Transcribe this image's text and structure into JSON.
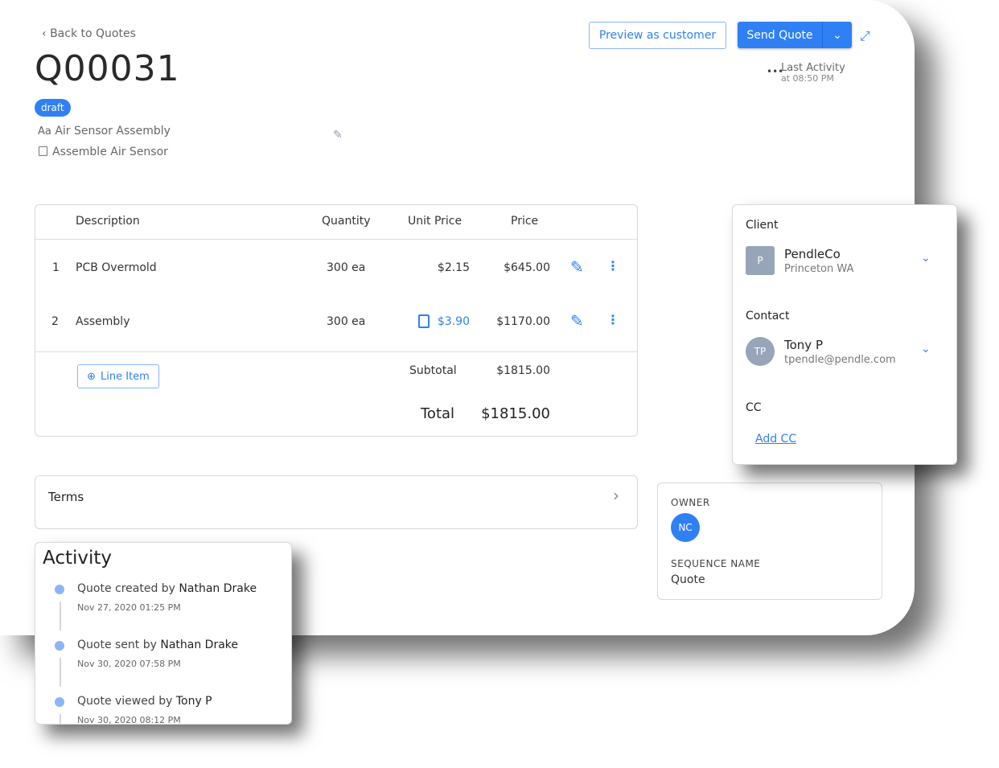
{
  "header": {
    "back_label": "Back to Quotes",
    "quote_id": "Q00031",
    "status": "draft",
    "name": "Air Sensor Assembly",
    "description": "Assemble Air Sensor",
    "preview_label": "Preview as customer",
    "send_label": "Send Quote",
    "last_activity_label": "Last Activity",
    "last_activity_time": "at 08:50 PM"
  },
  "table": {
    "columns": [
      "Description",
      "Quantity",
      "Unit Price",
      "Price"
    ],
    "rows": [
      {
        "num": "1",
        "description": "PCB Overmold",
        "quantity": "300 ea",
        "unit_price": "$2.15",
        "price": "$645.00"
      },
      {
        "num": "2",
        "description": "Assembly",
        "quantity": "300 ea",
        "unit_price": "$3.90",
        "price": "$1170.00"
      }
    ],
    "add_line_label": "Line Item",
    "subtotal_label": "Subtotal",
    "subtotal": "$1815.00",
    "total_label": "Total",
    "total": "$1815.00"
  },
  "terms": {
    "label": "Terms"
  },
  "client": {
    "label": "Client",
    "initial": "P",
    "name": "PendleCo",
    "location": "Princeton WA",
    "contact_label": "Contact",
    "contact_initials": "TP",
    "contact_name": "Tony P",
    "contact_email": "tpendle@pendle.com",
    "cc_label": "CC",
    "add_cc_label": "Add CC"
  },
  "owner": {
    "label": "OWNER",
    "initials": "NC",
    "sequence_label": "SEQUENCE NAME",
    "sequence_name": "Quote"
  },
  "activity": {
    "title": "Activity",
    "items": [
      {
        "text": "Quote created by",
        "actor": "Nathan Drake",
        "date": "Nov 27, 2020 01:25 PM"
      },
      {
        "text": "Quote sent by",
        "actor": "Nathan Drake",
        "date": "Nov 30, 2020 07:58 PM"
      },
      {
        "text": "Quote viewed by",
        "actor": "Tony P",
        "date": "Nov 30, 2020 08:12 PM"
      }
    ]
  },
  "colors": {
    "accent": "#2f80f5",
    "avatar": "#97a5b9"
  }
}
